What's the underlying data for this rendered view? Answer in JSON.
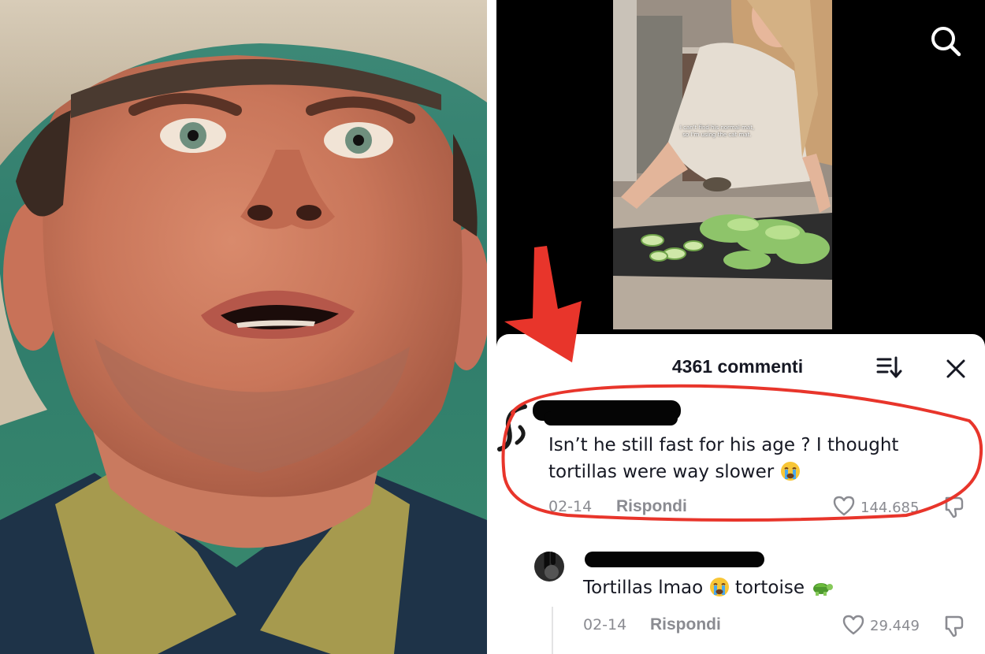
{
  "left_photo": {
    "icon": "startled-cowboy-photo"
  },
  "video": {
    "caption_line1": "I can't find his normal mat,",
    "caption_line2": "so I'm using the cat mat.",
    "search_icon": "search-icon"
  },
  "annotation": {
    "arrow_color": "#e8352b",
    "highlight_color": "#e8352b"
  },
  "comments": {
    "title": "4361 commenti",
    "sort_icon": "sort-icon",
    "close_icon": "close-icon",
    "items": [
      {
        "text_line1": "Isn’t he still fast for his age ? I thought",
        "text_line2": "tortillas were way slower",
        "emoji": "loudly-crying-face-emoji",
        "date": "02-14",
        "reply_label": "Rispondi",
        "likes": "144.685"
      },
      {
        "text_pre": "Tortillas lmao",
        "emoji1": "loudly-crying-face-emoji",
        "text_mid": "tortoise",
        "emoji2": "turtle-emoji",
        "date": "02-14",
        "reply_label": "Rispondi",
        "likes": "29.449"
      }
    ]
  },
  "colors": {
    "text": "#161823",
    "muted": "#8a8b91",
    "sheet_bg": "#ffffff"
  }
}
